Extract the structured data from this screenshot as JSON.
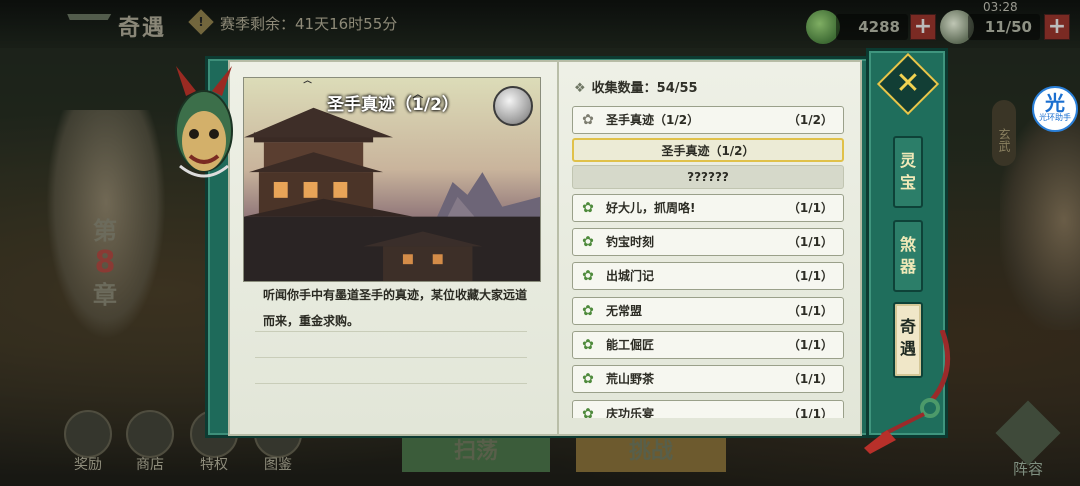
{
  "header": {
    "title": "奇遇",
    "season_remaining": "赛季剩余：41天16时55分",
    "currency_value": "4288",
    "stamina_value": "11/50",
    "plus_label": "+",
    "clock": "03:28"
  },
  "background": {
    "chapter_prefix": "第",
    "chapter_number": "8",
    "chapter_suffix": "章",
    "xuanwu_label": "玄武",
    "helper_glyph": "光",
    "helper_label": "光环助手",
    "bottom_nav": [
      {
        "label": "奖励"
      },
      {
        "label": "商店"
      },
      {
        "label": "特权"
      },
      {
        "label": "图鉴"
      }
    ],
    "sweep_label": "扫荡",
    "challenge_label": "挑战",
    "lineup_label": "阵容"
  },
  "detail": {
    "title": "圣手真迹（1/2）",
    "description": "听闻你手中有墨道圣手的真迹，某位收藏大家远道而来，重金求购。"
  },
  "collection": {
    "count_label": "收集数量：54/55",
    "expanded_entry": {
      "name": "圣手真迹（1/2）",
      "count": "（1/2）"
    },
    "sub_entries": [
      {
        "label": "圣手真迹（1/2）",
        "state": "selected"
      },
      {
        "label": "??????",
        "state": "locked"
      }
    ],
    "entries": [
      {
        "name": "好大儿，抓周咯!",
        "count": "（1/1）"
      },
      {
        "name": "钓宝时刻",
        "count": "（1/1）"
      },
      {
        "name": "出城门记",
        "count": "（1/1）"
      },
      {
        "name": "无常盟",
        "count": "（1/1）"
      },
      {
        "name": "能工倔匠",
        "count": "（1/1）"
      },
      {
        "name": "荒山野茶",
        "count": "（1/1）"
      },
      {
        "name": "庆功乐宴",
        "count": "（1/1）"
      }
    ]
  },
  "side_tabs": [
    {
      "label": "灵宝",
      "active": false
    },
    {
      "label": "煞器",
      "active": false
    },
    {
      "label": "奇遇",
      "active": true
    }
  ],
  "close_glyph": "✕",
  "colors": {
    "frame_green": "#1e6a5a",
    "paper": "#eef0e6",
    "selected_border": "#e0c14a",
    "close_gold": "#f2d351"
  }
}
